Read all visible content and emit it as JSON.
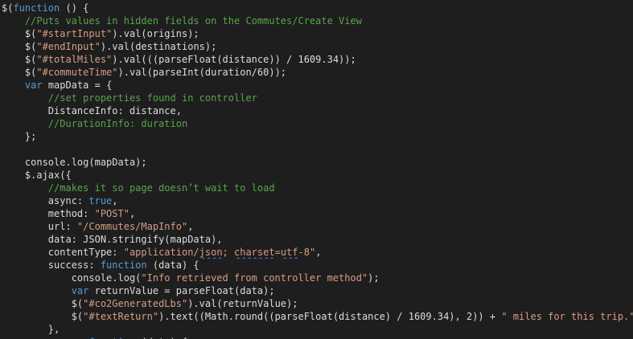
{
  "colors": {
    "background": "#1e1e1e",
    "plain": "#dcdcdc",
    "comment": "#57a64a",
    "keyword": "#569cd6",
    "string": "#d69d85",
    "squiggle": "#4a7fe0"
  },
  "code": {
    "lines": [
      [
        {
          "t": "p",
          "v": "$("
        },
        {
          "t": "k",
          "v": "function"
        },
        {
          "t": "p",
          "v": " () {"
        }
      ],
      [
        {
          "t": "p",
          "v": "    "
        },
        {
          "t": "c",
          "v": "//Puts values in hidden fields on the Commutes/Create View"
        }
      ],
      [
        {
          "t": "p",
          "v": "    $("
        },
        {
          "t": "s",
          "v": "\"#startInput\""
        },
        {
          "t": "p",
          "v": ").val(origins);"
        }
      ],
      [
        {
          "t": "p",
          "v": "    $("
        },
        {
          "t": "s",
          "v": "\"#endInput\""
        },
        {
          "t": "p",
          "v": ").val(destinations);"
        }
      ],
      [
        {
          "t": "p",
          "v": "    $("
        },
        {
          "t": "s",
          "v": "\"#totalMiles\""
        },
        {
          "t": "p",
          "v": ").val(((parseFloat(distance)) / 1609.34));"
        }
      ],
      [
        {
          "t": "p",
          "v": "    $("
        },
        {
          "t": "s",
          "v": "\"#commuteTime\""
        },
        {
          "t": "p",
          "v": ").val(parseInt(duration/60));"
        }
      ],
      [
        {
          "t": "p",
          "v": "    "
        },
        {
          "t": "k",
          "v": "var"
        },
        {
          "t": "p",
          "v": " mapData = {"
        }
      ],
      [
        {
          "t": "p",
          "v": "        "
        },
        {
          "t": "c",
          "v": "//set properties found in controller"
        }
      ],
      [
        {
          "t": "p",
          "v": "        DistanceInfo: distance,"
        }
      ],
      [
        {
          "t": "p",
          "v": "        "
        },
        {
          "t": "c",
          "v": "//DurationInfo: duration"
        }
      ],
      [
        {
          "t": "p",
          "v": "    };"
        }
      ],
      [],
      [
        {
          "t": "p",
          "v": "    console.log(mapData);"
        }
      ],
      [
        {
          "t": "p",
          "v": "    $.ajax({"
        }
      ],
      [
        {
          "t": "p",
          "v": "        "
        },
        {
          "t": "c",
          "v": "//makes it so page doesn’t wait to load"
        }
      ],
      [
        {
          "t": "p",
          "v": "        async: "
        },
        {
          "t": "k",
          "v": "true"
        },
        {
          "t": "p",
          "v": ","
        }
      ],
      [
        {
          "t": "p",
          "v": "        method: "
        },
        {
          "t": "s",
          "v": "\"POST\""
        },
        {
          "t": "p",
          "v": ","
        }
      ],
      [
        {
          "t": "p",
          "v": "        url: "
        },
        {
          "t": "s",
          "v": "\"/Commutes/MapInfo\""
        },
        {
          "t": "p",
          "v": ","
        }
      ],
      [
        {
          "t": "p",
          "v": "        data: JSON.stringify(mapData),"
        }
      ],
      [
        {
          "t": "p",
          "v": "        contentType: "
        },
        {
          "t": "s",
          "v": "\"application/"
        },
        {
          "t": "s",
          "v": "json",
          "sq": true
        },
        {
          "t": "s",
          "v": "; "
        },
        {
          "t": "s",
          "v": "charset",
          "sq": true
        },
        {
          "t": "s",
          "v": "="
        },
        {
          "t": "s",
          "v": "utf",
          "sq": true
        },
        {
          "t": "s",
          "v": "-8\""
        },
        {
          "t": "p",
          "v": ","
        }
      ],
      [
        {
          "t": "p",
          "v": "        success: "
        },
        {
          "t": "k",
          "v": "function"
        },
        {
          "t": "p",
          "v": " (data) {"
        }
      ],
      [
        {
          "t": "p",
          "v": "            console.log("
        },
        {
          "t": "s",
          "v": "\"Info retrieved from controller method\""
        },
        {
          "t": "p",
          "v": ");"
        }
      ],
      [
        {
          "t": "p",
          "v": "            "
        },
        {
          "t": "k",
          "v": "var"
        },
        {
          "t": "p",
          "v": " returnValue = parseFloat(data);"
        }
      ],
      [
        {
          "t": "p",
          "v": "            $("
        },
        {
          "t": "s",
          "v": "\"#co2GeneratedLbs\""
        },
        {
          "t": "p",
          "v": ").val(returnValue);"
        }
      ],
      [
        {
          "t": "p",
          "v": "            $("
        },
        {
          "t": "s",
          "v": "\"#textReturn\""
        },
        {
          "t": "p",
          "v": ").text((Math.round((parseFloat(distance) / 1609.34), 2)) + "
        },
        {
          "t": "s",
          "v": "\" miles for this trip.\""
        },
        {
          "t": "p",
          "v": ");"
        }
      ],
      [
        {
          "t": "p",
          "v": "        },"
        }
      ],
      [
        {
          "t": "p",
          "v": "        error: "
        },
        {
          "t": "k",
          "v": "function"
        },
        {
          "t": "p",
          "v": " (data) {"
        }
      ]
    ]
  }
}
